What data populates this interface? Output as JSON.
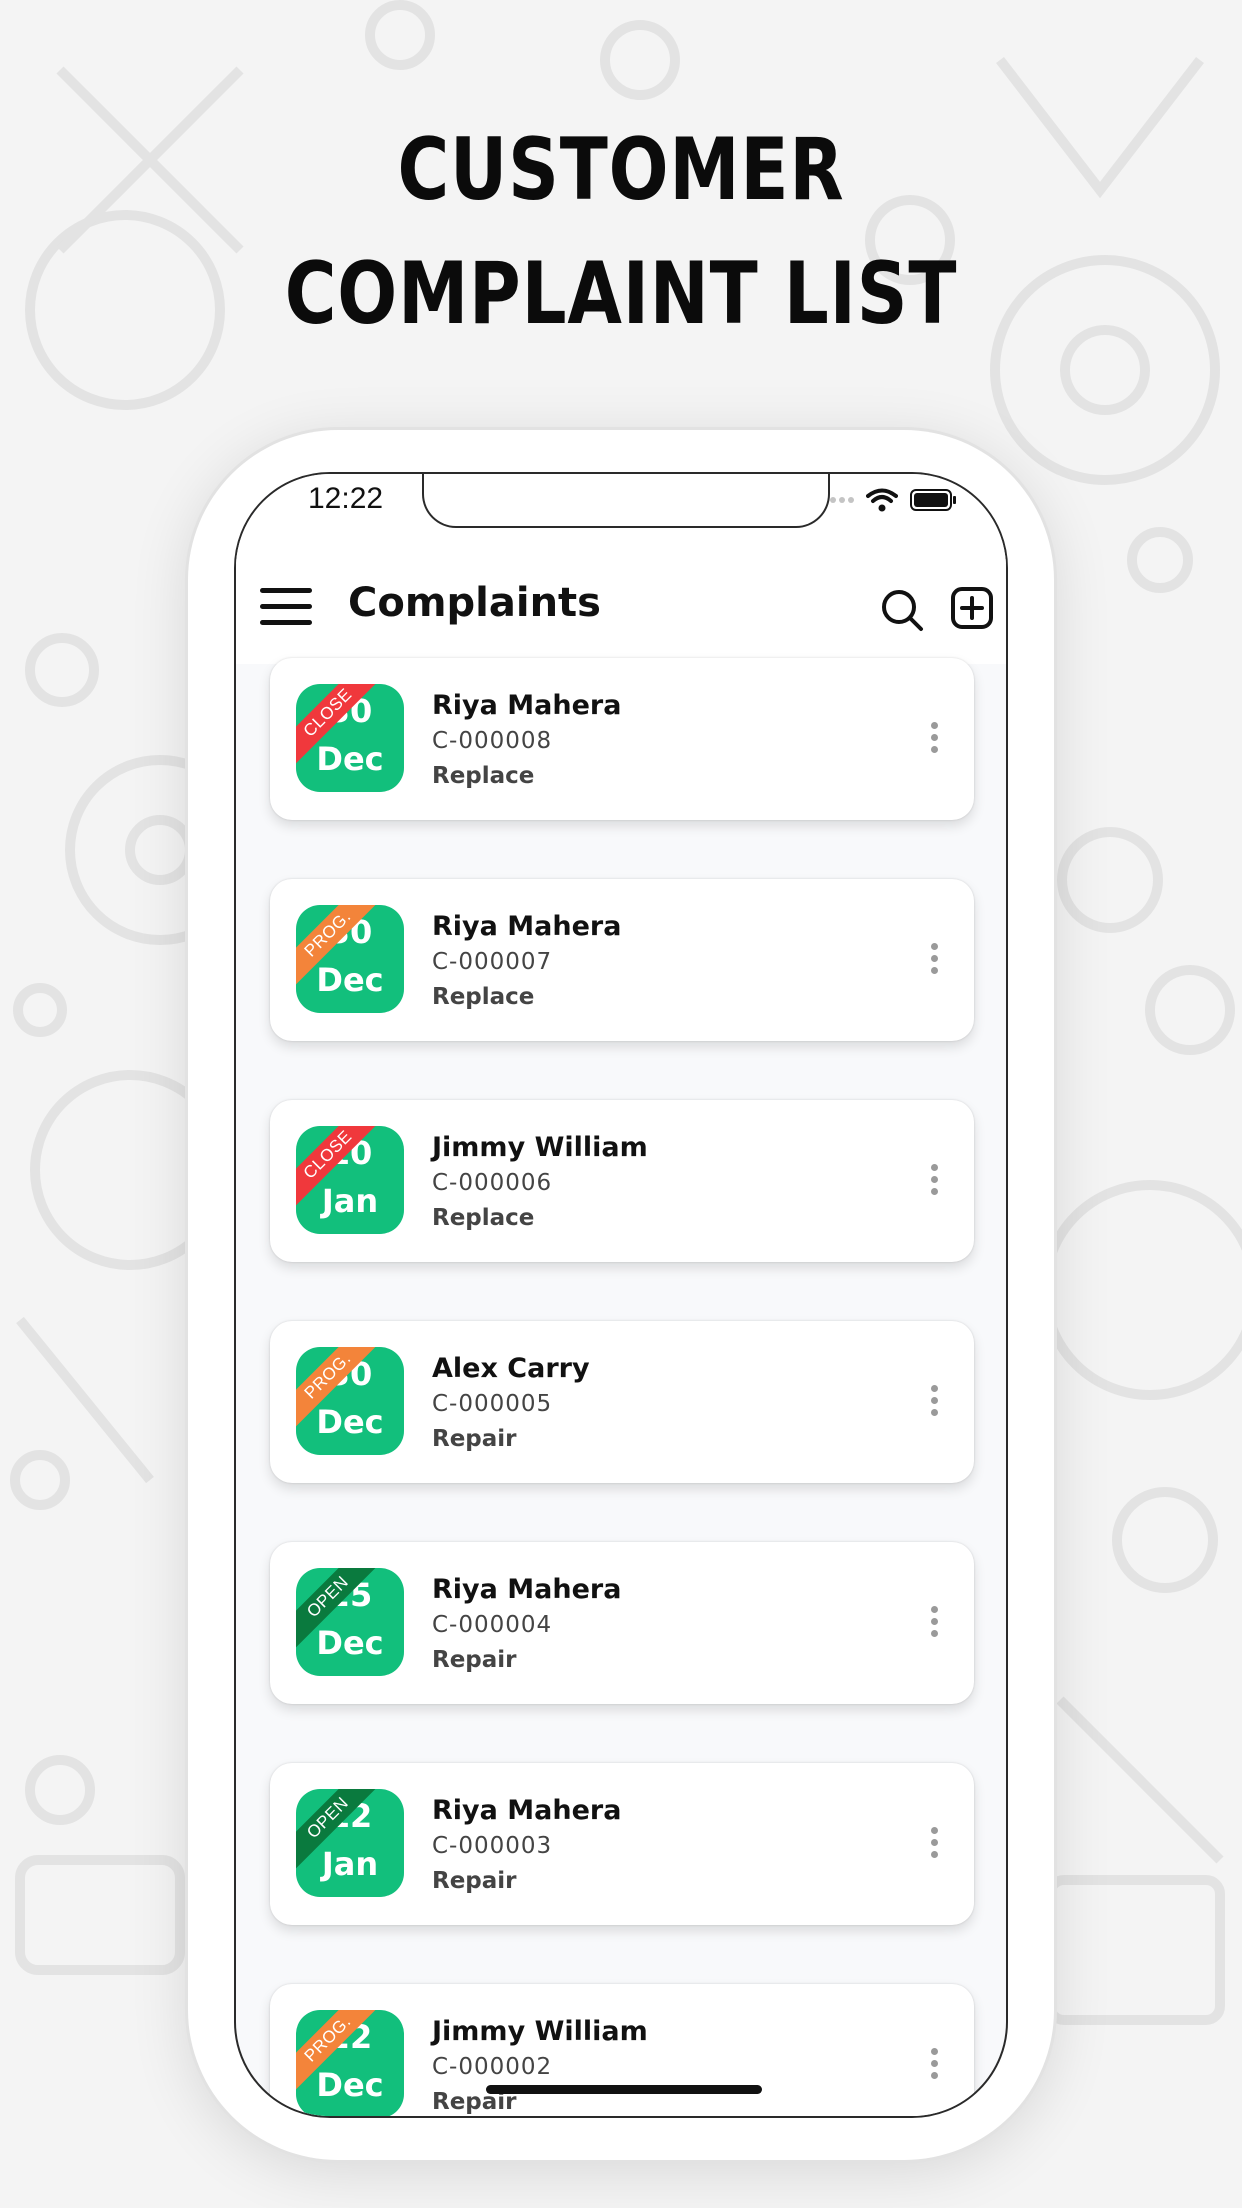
{
  "promo": {
    "title_line1": "CUSTOMER",
    "title_line2": "COMPLAINT LIST"
  },
  "status_bar": {
    "time": "12:22",
    "icons": [
      "signal-dots-icon",
      "wifi-icon",
      "battery-icon"
    ]
  },
  "app_bar": {
    "menu_icon": "hamburger-menu-icon",
    "title": "Complaints",
    "search_icon": "search-icon",
    "add_icon": "add-square-icon"
  },
  "colors": {
    "tile_green": "#12bf7c",
    "status_close": "#f0383c",
    "status_progress": "#f3843a",
    "status_open": "#0a7a3e"
  },
  "complaints": [
    {
      "status": "CLOSE",
      "status_key": "close",
      "day": "30",
      "month": "Dec",
      "name": "Riya Mahera",
      "id": "C-000008",
      "type": "Replace"
    },
    {
      "status": "PROG.",
      "status_key": "prog",
      "day": "30",
      "month": "Dec",
      "name": "Riya Mahera",
      "id": "C-000007",
      "type": "Replace"
    },
    {
      "status": "CLOSE",
      "status_key": "close",
      "day": "10",
      "month": "Jan",
      "name": "Jimmy William",
      "id": "C-000006",
      "type": "Replace"
    },
    {
      "status": "PROG.",
      "status_key": "prog",
      "day": "30",
      "month": "Dec",
      "name": "Alex Carry",
      "id": "C-000005",
      "type": "Repair"
    },
    {
      "status": "OPEN",
      "status_key": "open",
      "day": "25",
      "month": "Dec",
      "name": "Riya Mahera",
      "id": "C-000004",
      "type": "Repair"
    },
    {
      "status": "OPEN",
      "status_key": "open",
      "day": "12",
      "month": "Jan",
      "name": "Riya Mahera",
      "id": "C-000003",
      "type": "Repair"
    },
    {
      "status": "PROG.",
      "status_key": "prog",
      "day": "22",
      "month": "Dec",
      "name": "Jimmy William",
      "id": "C-000002",
      "type": "Repair"
    }
  ]
}
